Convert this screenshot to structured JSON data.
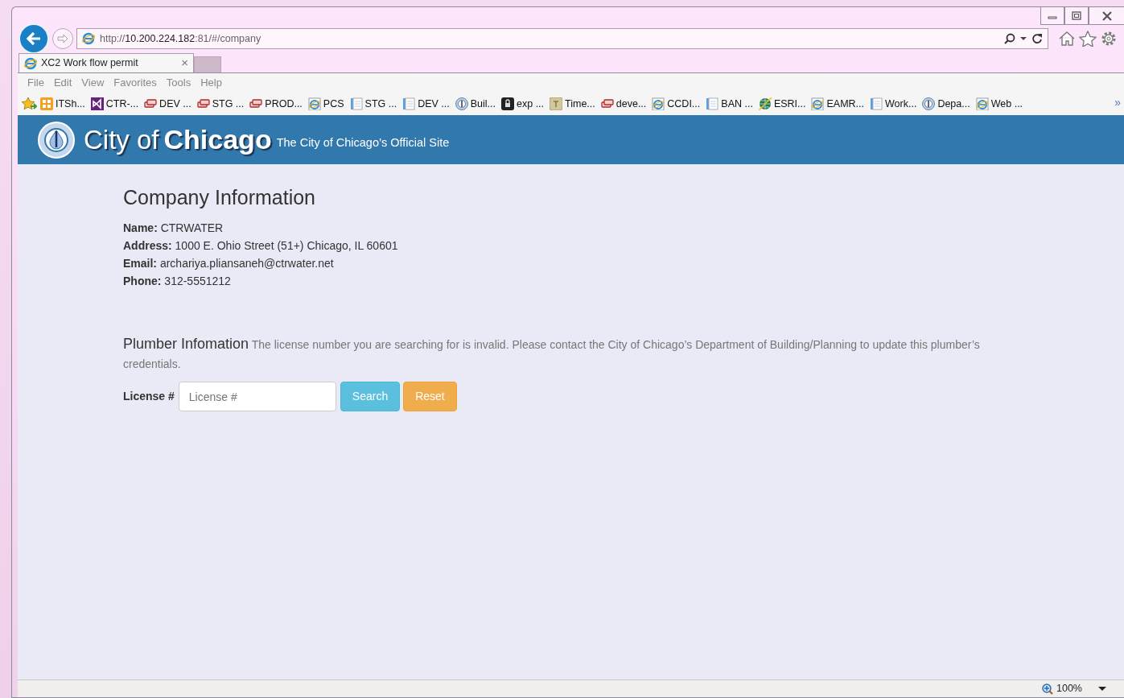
{
  "browser": {
    "address": {
      "scheme": "http://",
      "host": "10.200.224.182",
      "path": ":81/#/company"
    },
    "tabs": [
      {
        "title": "XC2 Work flow permit",
        "close": "×",
        "selected": true
      }
    ],
    "menu": [
      "File",
      "Edit",
      "View",
      "Favorites",
      "Tools",
      "Help"
    ],
    "bookmarks": [
      {
        "label": "ITSh...",
        "kind": "grid"
      },
      {
        "label": "CTR-...",
        "kind": "studio"
      },
      {
        "label": "DEV ...",
        "kind": "stack"
      },
      {
        "label": "STG ...",
        "kind": "stack"
      },
      {
        "label": "PROD...",
        "kind": "stack"
      },
      {
        "label": "PCS",
        "kind": "ie"
      },
      {
        "label": "STG ...",
        "kind": "doc"
      },
      {
        "label": "DEV ...",
        "kind": "doc"
      },
      {
        "label": "Buil...",
        "kind": "seal"
      },
      {
        "label": "exp ...",
        "kind": "lock"
      },
      {
        "label": "Time...",
        "kind": "tile"
      },
      {
        "label": "deve...",
        "kind": "stack"
      },
      {
        "label": "CCDI...",
        "kind": "ie"
      },
      {
        "label": "BAN ...",
        "kind": "doc"
      },
      {
        "label": "ESRI...",
        "kind": "globe"
      },
      {
        "label": "EAMR...",
        "kind": "ie"
      },
      {
        "label": "Work...",
        "kind": "doc"
      },
      {
        "label": "Depa...",
        "kind": "seal"
      },
      {
        "label": "Web ...",
        "kind": "ie"
      }
    ],
    "bookmarks_more": "»",
    "zoom": "100%"
  },
  "header": {
    "logo_light": "City of",
    "logo_bold": "Chicago",
    "tagline": "The City of Chicago’s Official Site"
  },
  "company": {
    "title": "Company Information",
    "fields": [
      {
        "label": "Name:",
        "value": "CTRWATER"
      },
      {
        "label": "Address:",
        "value": "1000 E. Ohio Street (51+) Chicago, IL 60601"
      },
      {
        "label": "Email:",
        "value": "archariya.pliansaneh@ctrwater.net"
      },
      {
        "label": "Phone:",
        "value": "312-5551212"
      }
    ]
  },
  "plumber": {
    "title": "Plumber Infomation",
    "message": "The license number you are searching for is invalid. Please contact the City of Chicago’s Department of Building/Planning to update this plumber’s credentials.",
    "license_label": "License #",
    "license_placeholder": "License #",
    "buttons": [
      {
        "label": "Search",
        "kind": "info"
      },
      {
        "label": "Reset",
        "kind": "warning"
      }
    ]
  }
}
